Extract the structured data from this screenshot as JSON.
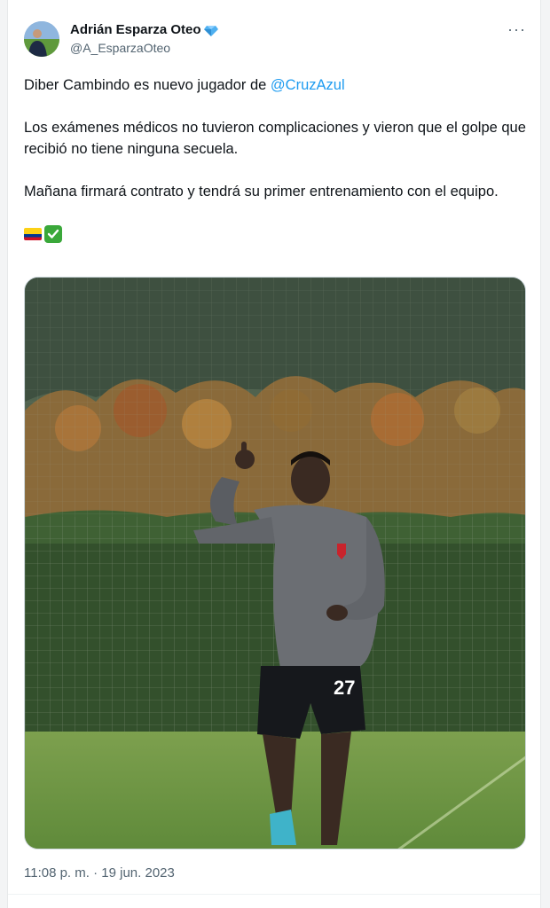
{
  "author": {
    "display_name": "Adrián Esparza Oteo",
    "handle": "@A_EsparzaOteo",
    "verified_badge_icon": "diamond-icon",
    "verified_badge_color": "#4fb0f0"
  },
  "menu": {
    "more_icon": "ellipsis-icon",
    "more_label": "···"
  },
  "tweet": {
    "line1_prefix": "Diber Cambindo es nuevo jugador de ",
    "mention": "@CruzAzul",
    "paragraph2": "Los exámenes médicos no tuvieron complicaciones y vieron que el golpe que recibió no tiene ninguna secuela.",
    "paragraph3": "Mañana firmará contrato y tendrá su primer entrenamiento con el equipo.",
    "emojis": [
      "flag-colombia-icon",
      "check-mark-icon"
    ],
    "mention_color": "#1d9bf0"
  },
  "media": {
    "jersey_number": "27"
  },
  "meta": {
    "time": "11:08 p. m.",
    "separator": " · ",
    "date": "19 jun. 2023"
  }
}
